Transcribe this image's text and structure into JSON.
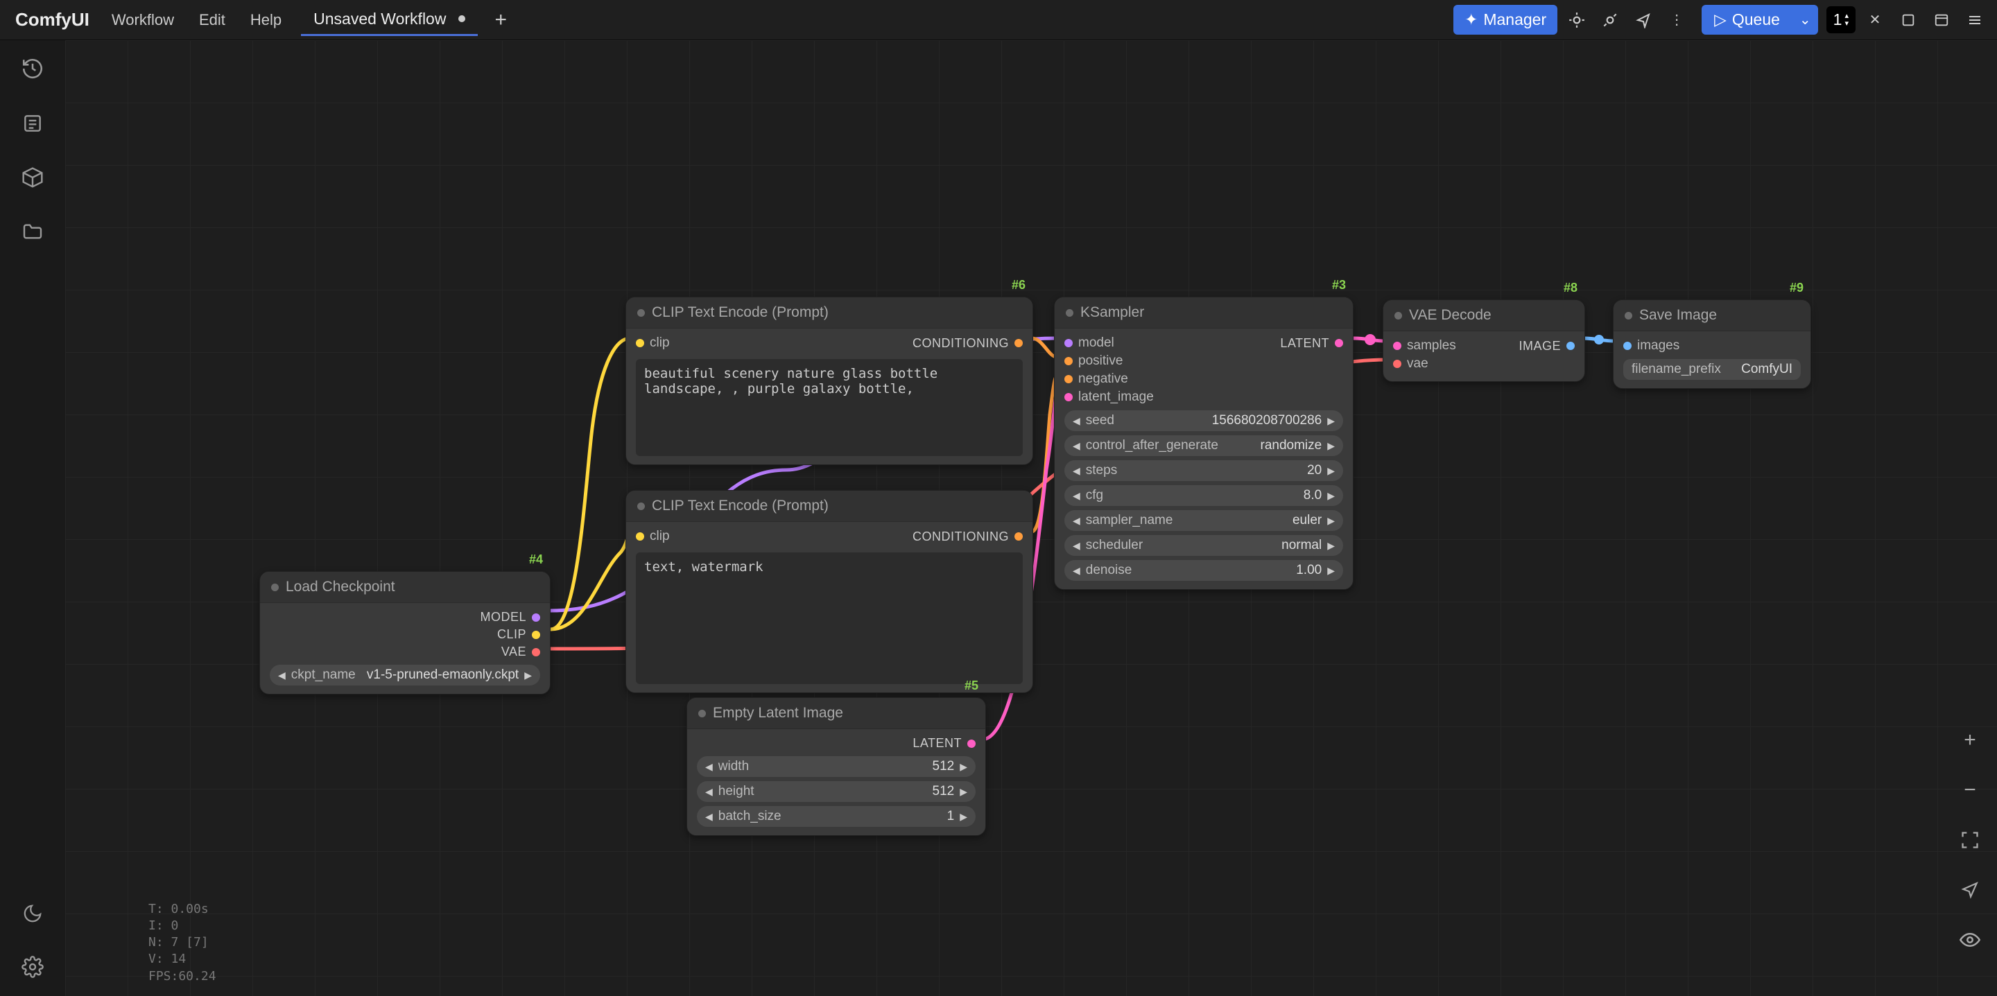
{
  "app": {
    "name": "ComfyUI"
  },
  "menu": {
    "workflow": "Workflow",
    "edit": "Edit",
    "help": "Help"
  },
  "tab": {
    "title": "Unsaved Workflow"
  },
  "topbar": {
    "manager": "Manager",
    "queue": "Queue",
    "count": "1"
  },
  "stats": {
    "t": "T: 0.00s",
    "i": "I: 0",
    "n": "N: 7 [7]",
    "v": "V: 14",
    "fps": "FPS:60.24"
  },
  "nodes": {
    "load_checkpoint": {
      "badge": "#4",
      "title": "Load Checkpoint",
      "outputs": {
        "model": "MODEL",
        "clip": "CLIP",
        "vae": "VAE"
      },
      "widget": {
        "label": "ckpt_name",
        "value": "v1-5-pruned-emaonly.ckpt"
      }
    },
    "clip_pos": {
      "badge": "#6",
      "title": "CLIP Text Encode (Prompt)",
      "inputs": {
        "clip": "clip"
      },
      "outputs": {
        "cond": "CONDITIONING"
      },
      "text": "beautiful scenery nature glass bottle landscape, , purple galaxy bottle,"
    },
    "clip_neg": {
      "badge": "",
      "title": "CLIP Text Encode (Prompt)",
      "inputs": {
        "clip": "clip"
      },
      "outputs": {
        "cond": "CONDITIONING"
      },
      "text": "text, watermark"
    },
    "empty_latent": {
      "badge": "#5",
      "title": "Empty Latent Image",
      "outputs": {
        "latent": "LATENT"
      },
      "widgets": [
        {
          "label": "width",
          "value": "512"
        },
        {
          "label": "height",
          "value": "512"
        },
        {
          "label": "batch_size",
          "value": "1"
        }
      ]
    },
    "ksampler": {
      "badge": "#3",
      "title": "KSampler",
      "inputs": {
        "model": "model",
        "positive": "positive",
        "negative": "negative",
        "latent_image": "latent_image"
      },
      "outputs": {
        "latent": "LATENT"
      },
      "widgets": [
        {
          "label": "seed",
          "value": "156680208700286"
        },
        {
          "label": "control_after_generate",
          "value": "randomize"
        },
        {
          "label": "steps",
          "value": "20"
        },
        {
          "label": "cfg",
          "value": "8.0"
        },
        {
          "label": "sampler_name",
          "value": "euler"
        },
        {
          "label": "scheduler",
          "value": "normal"
        },
        {
          "label": "denoise",
          "value": "1.00"
        }
      ]
    },
    "vae_decode": {
      "badge": "#8",
      "title": "VAE Decode",
      "inputs": {
        "samples": "samples",
        "vae": "vae"
      },
      "outputs": {
        "image": "IMAGE"
      }
    },
    "save_image": {
      "badge": "#9",
      "title": "Save Image",
      "inputs": {
        "images": "images"
      },
      "widget": {
        "label": "filename_prefix",
        "value": "ComfyUI"
      }
    }
  }
}
